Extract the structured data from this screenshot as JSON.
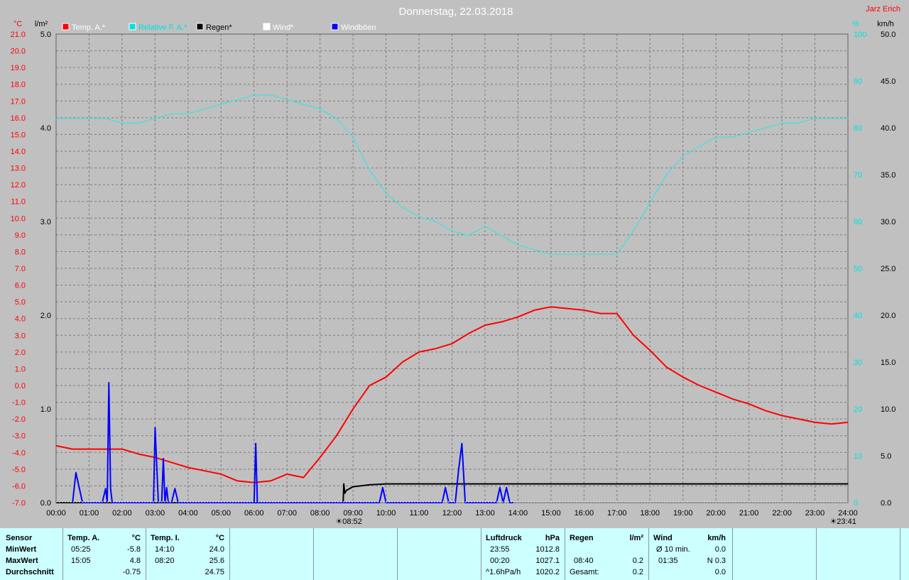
{
  "header": {
    "title": "Donnerstag, 22.03.2018",
    "station": "Jarz Erich"
  },
  "colors": {
    "temp": "#ff0000",
    "pressure": "#00e0e0",
    "rain": "#000000",
    "wind": "#ffffff",
    "gusts": "#0000ff",
    "background": "#c0c0c0",
    "grid": "#808080",
    "table_bg": "#ccffff"
  },
  "axes": {
    "temp_unit": "°C",
    "rain_unit": "l/m²",
    "pressure_unit": "%",
    "wind_unit": "km/h",
    "temp_ticks": [
      "21.0",
      "20.0",
      "19.0",
      "18.0",
      "17.0",
      "16.0",
      "15.0",
      "14.0",
      "13.0",
      "12.0",
      "11.0",
      "10.0",
      "9.0",
      "8.0",
      "7.0",
      "6.0",
      "5.0",
      "4.0",
      "3.0",
      "2.0",
      "1.0",
      "0.0",
      "-1.0",
      "-2.0",
      "-3.0",
      "-4.0",
      "-5.0",
      "-6.0",
      "-7.0"
    ],
    "rain_ticks": [
      "5.0",
      "4.0",
      "3.0",
      "2.0",
      "1.0",
      "0.0"
    ],
    "pressure_ticks": [
      "100",
      "90",
      "80",
      "70",
      "60",
      "50",
      "40",
      "30",
      "20",
      "10",
      "0"
    ],
    "wind_ticks": [
      "50.0",
      "45.0",
      "40.0",
      "35.0",
      "30.0",
      "25.0",
      "20.0",
      "15.0",
      "10.0",
      "5.0",
      "0.0"
    ],
    "time_ticks": [
      "00:00",
      "01:00",
      "02:00",
      "03:00",
      "04:00",
      "05:00",
      "06:00",
      "07:00",
      "08:00",
      "09:00",
      "10:00",
      "11:00",
      "12:00",
      "13:00",
      "14:00",
      "15:00",
      "16:00",
      "17:00",
      "18:00",
      "19:00",
      "20:00",
      "21:00",
      "22:00",
      "23:00",
      "24:00"
    ],
    "sunrise_label": "08:52",
    "sunset_label": "23:41"
  },
  "legend": [
    {
      "label": "Temp. A.*",
      "color": "#ff0000"
    },
    {
      "label": "Relative F. A.*",
      "color": "#00e0e0"
    },
    {
      "label": "Regen*",
      "color": "#000000"
    },
    {
      "label": "Wind*",
      "color": "#ffffff"
    },
    {
      "label": "Windböen",
      "color": "#0000ff"
    }
  ],
  "chart_data": {
    "type": "line",
    "xlabel": "",
    "xlim": [
      0,
      24
    ],
    "series": [
      {
        "name": "Temp. A.*",
        "axis": "°C",
        "ylim": [
          -7,
          21
        ],
        "x": [
          0,
          0.5,
          1,
          1.5,
          2,
          2.5,
          3,
          3.5,
          4,
          4.5,
          5,
          5.5,
          6,
          6.5,
          7,
          7.5,
          8,
          8.5,
          9,
          9.5,
          10,
          10.5,
          11,
          11.5,
          12,
          12.5,
          13,
          13.5,
          14,
          14.5,
          15,
          15.5,
          16,
          16.5,
          17,
          17.5,
          18,
          18.5,
          19,
          19.5,
          20,
          20.5,
          21,
          21.5,
          22,
          22.5,
          23,
          23.5,
          24
        ],
        "y": [
          -3.6,
          -3.8,
          -3.8,
          -3.8,
          -3.8,
          -4.1,
          -4.3,
          -4.6,
          -4.9,
          -5.1,
          -5.3,
          -5.7,
          -5.8,
          -5.7,
          -5.3,
          -5.5,
          -4.3,
          -3.0,
          -1.4,
          0.0,
          0.5,
          1.4,
          2.0,
          2.2,
          2.5,
          3.1,
          3.6,
          3.8,
          4.1,
          4.5,
          4.7,
          4.6,
          4.5,
          4.3,
          4.3,
          3.0,
          2.1,
          1.1,
          0.5,
          0.0,
          -0.4,
          -0.8,
          -1.1,
          -1.5,
          -1.8,
          -2.0,
          -2.2,
          -2.3,
          -2.2
        ]
      },
      {
        "name": "Relative F. A.*",
        "axis": "%",
        "ylim": [
          0,
          100
        ],
        "x": [
          0,
          0.5,
          1,
          1.5,
          2,
          2.5,
          3,
          3.5,
          4,
          4.5,
          5,
          5.5,
          6,
          6.5,
          7,
          7.5,
          8,
          8.5,
          9,
          9.5,
          10,
          10.5,
          11,
          11.5,
          12,
          12.5,
          13,
          13.5,
          14,
          14.5,
          15,
          15.5,
          16,
          16.5,
          17,
          17.5,
          18,
          18.5,
          19,
          19.5,
          20,
          20.5,
          21,
          21.5,
          22,
          22.5,
          23,
          23.5,
          24
        ],
        "y": [
          82,
          82,
          82,
          82,
          81,
          81,
          82,
          83,
          83,
          84,
          85,
          86,
          87,
          87,
          86,
          85,
          84,
          82,
          78,
          71,
          66,
          63,
          61,
          60,
          58,
          57,
          59,
          57,
          55,
          54,
          53,
          53,
          53,
          53,
          53,
          58,
          64,
          70,
          74,
          76,
          78,
          78,
          79,
          80,
          81,
          81,
          82,
          82,
          82
        ]
      },
      {
        "name": "Regen*",
        "axis": "l/m²",
        "ylim": [
          0,
          5
        ],
        "x": [
          0,
          8.7,
          8.72,
          8.75,
          8.8,
          9,
          9.5,
          10,
          24
        ],
        "y": [
          0,
          0,
          0.2,
          0.1,
          0.13,
          0.17,
          0.19,
          0.2,
          0.2
        ]
      },
      {
        "name": "Windböen",
        "axis": "km/h",
        "ylim": [
          0,
          50
        ],
        "x": [
          0.5,
          0.6,
          0.8,
          1.4,
          1.5,
          1.55,
          1.6,
          1.65,
          1.7,
          1.8,
          2.95,
          3.0,
          3.1,
          3.2,
          3.25,
          3.3,
          3.35,
          3.4,
          3.5,
          3.6,
          3.7,
          3.8,
          3.9,
          6.0,
          6.05,
          6.1,
          6.2,
          9.8,
          9.9,
          10.0,
          11.7,
          11.8,
          11.9,
          12.1,
          12.2,
          12.3,
          12.4,
          13.35,
          13.45,
          13.55,
          13.65,
          13.75,
          13.85
        ],
        "y": [
          0,
          3.2,
          0,
          0,
          1.5,
          0,
          12.8,
          1.5,
          0,
          0,
          0,
          8,
          0,
          0,
          4.7,
          0,
          1.6,
          0,
          0,
          1.5,
          0,
          0,
          0,
          0,
          6.3,
          0,
          0,
          0,
          1.6,
          0,
          0,
          1.6,
          0,
          0,
          3.5,
          6.3,
          0,
          0,
          1.6,
          0,
          1.6,
          0,
          0
        ]
      }
    ]
  },
  "table": {
    "headers": {
      "sensor": "Sensor",
      "temp_a": "Temp. A.",
      "temp_a_unit": "°C",
      "temp_i": "Temp. I.",
      "temp_i_unit": "°C",
      "pressure": "Luftdruck",
      "pressure_unit": "hPa",
      "rain": "Regen",
      "rain_unit": "l/m²",
      "wind": "Wind",
      "wind_unit": "km/h"
    },
    "rows": [
      {
        "label": "MinWert",
        "ta_time": "05:25",
        "ta_val": "-5.8",
        "ti_time": "14:10",
        "ti_val": "24.0",
        "p_time": "23:55",
        "p_val": "1012.8",
        "r_time": "",
        "r_val": "",
        "w_time": "Ø 10 min.",
        "w_val": "0.0"
      },
      {
        "label": "MaxWert",
        "ta_time": "15:05",
        "ta_val": "4.8",
        "ti_time": "08:20",
        "ti_val": "25.6",
        "p_time": "00:20",
        "p_val": "1027.1",
        "r_time": "08:40",
        "r_val": "0.2",
        "w_time": "01:35",
        "w_val": "N 0.3"
      },
      {
        "label": "Durchschnitt",
        "ta_time": "",
        "ta_val": "-0.75",
        "ti_time": "",
        "ti_val": "24.75",
        "p_time": "^1.6hPa/h",
        "p_val": "1020.2",
        "r_time": "Gesamt:",
        "r_val": "0.2",
        "w_time": "",
        "w_val": "0.0"
      }
    ]
  }
}
